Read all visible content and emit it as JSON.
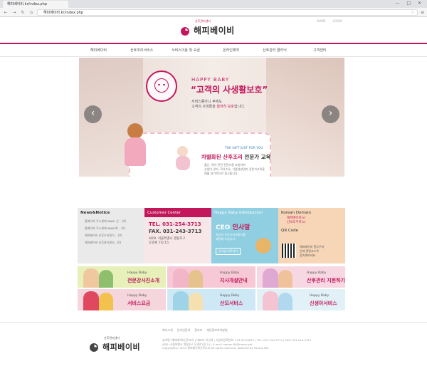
{
  "browser": {
    "tab_title": "해피베이비.kr/index.php",
    "url": "해피베이비.kr/index.php",
    "window_controls": "— □ ✕"
  },
  "header": {
    "util_links": [
      "HOME",
      "LOGIN"
    ],
    "logo_text": "해피베이비",
    "logo_sub": "산후관리센터"
  },
  "gnb": [
    "해피베이비",
    "산후조리서비스",
    "서비스이용 및 요금",
    "온라인예약",
    "산후관리 클리닉",
    "고객센터"
  ],
  "hero": {
    "tag": "HAPPY BABY",
    "title": "“고객의 사생활보호”",
    "desc1": "서비스종아니 후에도",
    "desc2_pre": "고객의 사생활을 ",
    "desc2_em": "철저히 보호",
    "desc2_post": "합니다.",
    "gift_tag": "THE GIFT JUST FOR YOU",
    "gift_title_em": "차별화된 산후조리",
    "gift_title_rest": " 전문가 교육",
    "gift_desc1": "출산, 육아 관련 전문자들 초빙하여",
    "gift_desc2": "신생아 관리, 모유수유, 식품영양관리 전문가교육을",
    "gift_desc3": "매월 정기적으로 실시합니다.",
    "prev": "‹",
    "next": "›"
  },
  "news": {
    "title": "News&Notice",
    "items": [
      "홈페이지 주소창에 www. 신 ...(0)",
      "홈페이지 주소창에 www.해 ...(0)",
      "해피베이비 산후조리원이 ...(0)",
      "해피베이비 산후관리센타...(0)"
    ]
  },
  "customer": {
    "title": "Customer Center",
    "tel": "TEL. 031-254-3713",
    "fax": "FAX. 031-243-3713",
    "addr1": "ADD. 서울특별시 영등포구",
    "addr2": "도영로 7길 15"
  },
  "intro": {
    "title": "Happy Baby Infroduction",
    "ceo_pre": "CEO ",
    "ceo_em": "인사말",
    "desc1": "최상의 산후조리서비스를",
    "desc2": "제공해 드립니다.",
    "button": "인사말 바로가기"
  },
  "domain": {
    "title": "Korean Domain",
    "txt1": "해피베이비.kr",
    "txt2": "산모도우미.kr",
    "qr_title": "QR Code",
    "qr_desc1": "해피베이비 홈도우미",
    "qr_desc2": "인에 큐알코드로",
    "qr_desc3": "접속해보세요."
  },
  "banners": [
    {
      "sm": "Happy Baby",
      "lg": "전문강사진소개",
      "pic": "#f0c8a0",
      "pic2": "#8fbf6c",
      "bg": "#e6f0b8"
    },
    {
      "sm": "Happy Baby",
      "lg": "지사개설안내",
      "pic": "#f3b6c9",
      "pic2": "#e6c28c",
      "bg": "#f7c9d6"
    },
    {
      "sm": "Happy Baby",
      "lg": "산후관리 지원하기",
      "pic": "#e0a9d3",
      "pic2": "#f0c29c",
      "bg": "#f7d8e2"
    },
    {
      "sm": "Happy Baby",
      "lg": "서비스요금",
      "pic": "#e04860",
      "pic2": "#f2c14e",
      "bg": "#f4d6dc"
    },
    {
      "sm": "Happy Baby",
      "lg": "산모서비스",
      "pic": "#9ed3e8",
      "pic2": "#f5e0b0",
      "bg": "#cfe8f5"
    },
    {
      "sm": "Happy Baby",
      "lg": "신생아서비스",
      "pic": "#f4c4d2",
      "pic2": "#b0d8ee",
      "bg": "#e2f1f7"
    }
  ],
  "footer": {
    "links": [
      "회사소개",
      "온라인문의",
      "관리자",
      "개인정보처리방침"
    ],
    "logo_text": "해피베이비",
    "logo_sub": "산후관리센터",
    "info1": "상호명: 해피베이비산후조리 | 대표자: 이선희 | 사업자등록번호: 124-54-59853 | TEL: 031-254-3713 | FAX: 031-243-3713",
    "info2": "ADD: 서울특별시 영등포구 도영로7길 15 | E-mail: hamon.84@naver.net",
    "info3": "Copyright(c) 2015 해피베이비산후조리 All rights reserved. powered by Sennio INC"
  },
  "colors": {
    "accent": "#c2185b"
  }
}
